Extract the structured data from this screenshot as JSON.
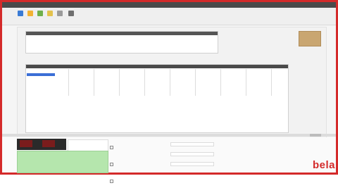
{
  "window": {
    "brand_text": "bela"
  },
  "toolbar": {
    "buttons": [
      {
        "icon": "open-icon",
        "color": "#3a7bd5"
      },
      {
        "icon": "image-icon",
        "color": "#f2b233"
      },
      {
        "icon": "scan-icon",
        "color": "#6fb04b"
      },
      {
        "icon": "label-icon",
        "color": "#e3c24d"
      },
      {
        "icon": "export-icon",
        "color": "#9b9b9b"
      },
      {
        "icon": "settings-icon",
        "color": "#6f6f6f"
      }
    ]
  },
  "colors": {
    "accent_border": "#d42a2a",
    "selected_row": "#3b6fd6",
    "result_panel": "#b5e6ad",
    "thumbnail": "#c9a671"
  }
}
